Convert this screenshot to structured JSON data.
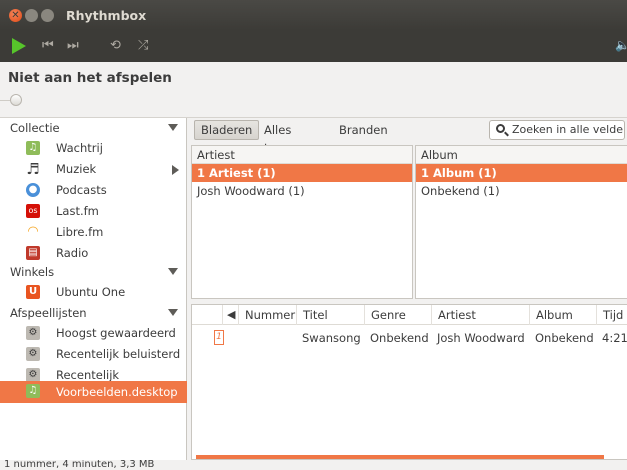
{
  "window": {
    "title": "Rhythmbox",
    "close_glyph": "✕"
  },
  "toolbar": {
    "prev_glyph": "⏮",
    "next_glyph": "⏭",
    "repeat_glyph": "⟲",
    "shuffle_glyph": "⤮",
    "volume_glyph": "🔈"
  },
  "status": {
    "now_playing": "Niet aan het afspelen"
  },
  "sidebar": {
    "collectie": "Collectie",
    "collectie_items": [
      "Wachtrij",
      "Muziek",
      "Podcasts",
      "Last.fm",
      "Libre.fm",
      "Radio"
    ],
    "winkels": "Winkels",
    "winkels_items": [
      "Ubuntu One"
    ],
    "afspeellijsten": "Afspeellijsten",
    "afspeellijsten_items": [
      "Hoogst gewaardeerd",
      "Recentelijk beluisterd",
      "Recentelijk toegevoegd",
      "Voorbeelden.desktop"
    ]
  },
  "tabs": {
    "browse": "Bladeren",
    "show_all": "Alles tonen",
    "burn": "Branden"
  },
  "search": {
    "placeholder": "Zoeken in alle velden"
  },
  "artist_pane": {
    "header": "Artiest",
    "rows": [
      "1 Artiest (1)",
      "Josh Woodward (1)"
    ]
  },
  "album_pane": {
    "header": "Album",
    "rows": [
      "1 Album (1)",
      "Onbekend (1)"
    ]
  },
  "tracks": {
    "columns": [
      "Nummer",
      "Titel",
      "Genre",
      "Artiest",
      "Album",
      "Tijd"
    ],
    "rows": [
      {
        "position": "1",
        "number": "",
        "title": "Swansong",
        "genre": "Onbekend",
        "artist": "Josh Woodward",
        "album": "Onbekend",
        "time": "4:21"
      }
    ]
  },
  "statusbar": {
    "text": "1 nummer, 4 minuten, 3,3 MB"
  },
  "colors": {
    "accent": "#f07746",
    "play": "#57c52b",
    "titlebar": "#3c3b37"
  }
}
